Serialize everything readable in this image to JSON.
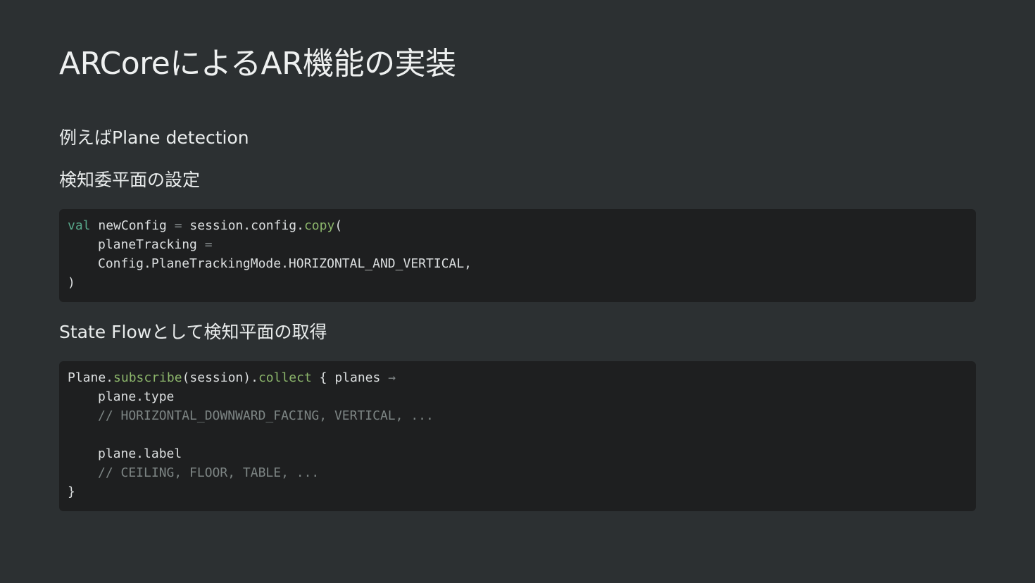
{
  "slide": {
    "title": "ARCoreによるAR機能の実装"
  },
  "sections": {
    "example_heading": "例えばPlane detection",
    "config_heading": "検知委平面の設定",
    "flow_heading": "State Flowとして検知平面の取得"
  },
  "code1": {
    "kw_val": "val",
    "l1_a": " newConfig ",
    "l1_eq": "=",
    "l1_b": " session.config.",
    "l1_fn": "copy",
    "l1_c": "(",
    "l2_a": "planeTracking ",
    "l2_eq": "=",
    "l3": "Config.PlaneTrackingMode.HORIZONTAL_AND_VERTICAL,",
    "l4": ")"
  },
  "code2": {
    "l1_a": "Plane.",
    "l1_fn1": "subscribe",
    "l1_b": "(session).",
    "l1_fn2": "collect",
    "l1_c": " { planes ",
    "l1_arrow": "→",
    "l2": "plane.type",
    "l3": "// HORIZONTAL_DOWNWARD_FACING, VERTICAL, ...",
    "l5": "plane.label",
    "l6": "// CEILING, FLOOR, TABLE, ...",
    "l7": "}"
  },
  "colors": {
    "background": "#2c3032",
    "code_background": "#1e1f20",
    "keyword": "#58a88b",
    "function": "#8cb66b",
    "comment": "#7d8584",
    "text": "#e9ecec"
  }
}
